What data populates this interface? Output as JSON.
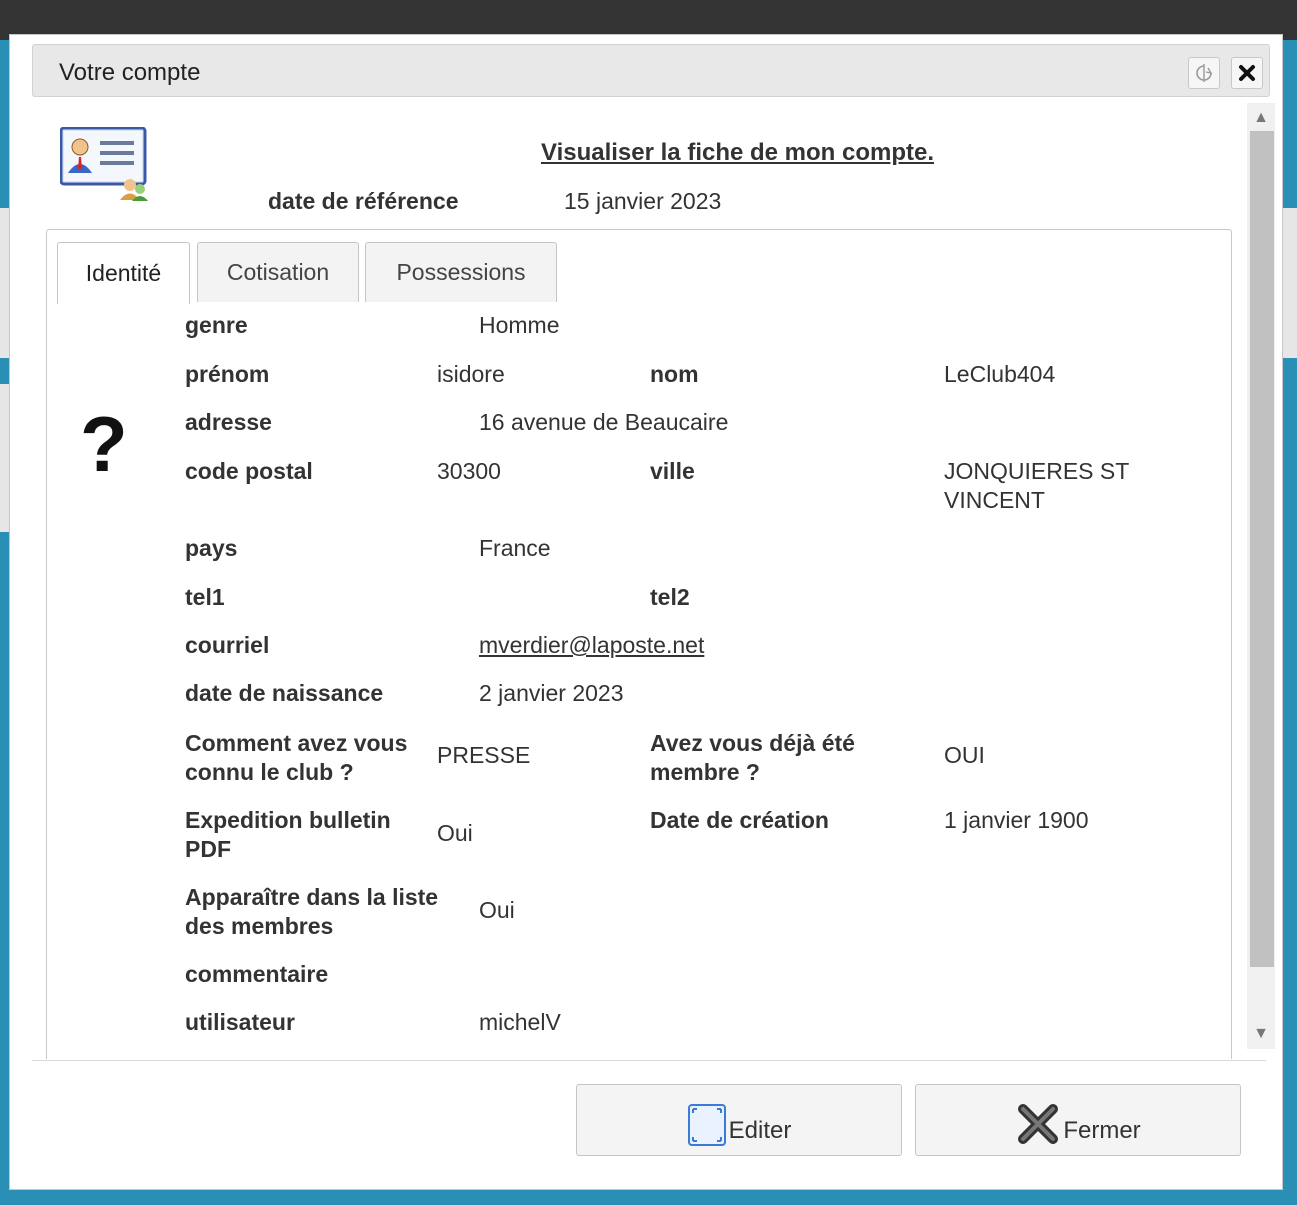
{
  "dialog": {
    "title": "Votre compte",
    "refresh_icon": "refresh-icon",
    "close_icon": "close-icon"
  },
  "header": {
    "account_icon": "account-card-icon",
    "view_link": "Visualiser la fiche de mon compte.",
    "ref_label": "date de référence",
    "ref_value": "15 janvier 2023"
  },
  "tabs": [
    {
      "label": "Identité",
      "active": true
    },
    {
      "label": "Cotisation",
      "active": false
    },
    {
      "label": "Possessions",
      "active": false
    }
  ],
  "identity": {
    "photo_placeholder": "?",
    "genre_label": "genre",
    "genre_value": "Homme",
    "prenom_label": "prénom",
    "prenom_value": "isidore",
    "nom_label": "nom",
    "nom_value": "LeClub404",
    "adresse_label": "adresse",
    "adresse_value": "16 avenue de Beaucaire",
    "cp_label": "code postal",
    "cp_value": "30300",
    "ville_label": "ville",
    "ville_value_1": "JONQUIERES ST",
    "ville_value_2": "VINCENT",
    "pays_label": "pays",
    "pays_value": "France",
    "tel1_label": "tel1",
    "tel2_label": "tel2",
    "courriel_label": "courriel",
    "courriel_value": "mverdier@laposte.net",
    "naissance_label": "date de naissance",
    "naissance_value": "2 janvier 2023",
    "connu_label_1": "Comment avez vous",
    "connu_label_2": "connu le club ?",
    "connu_value": "PRESSE",
    "membre_label_1": "Avez vous déjà été",
    "membre_label_2": "membre ?",
    "membre_value": "OUI",
    "expedition_label_1": "Expedition bulletin",
    "expedition_label_2": "PDF",
    "expedition_value": "Oui",
    "creation_label": "Date de création",
    "creation_value": "1 janvier 1900",
    "liste_label_1": "Apparaître dans la liste",
    "liste_label_2": "des membres",
    "liste_value": "Oui",
    "commentaire_label": "commentaire",
    "utilisateur_label": "utilisateur",
    "utilisateur_value": "michelV"
  },
  "footer": {
    "edit_label": "Editer",
    "edit_icon": "edit-icon",
    "close_label": "Fermer",
    "close_icon": "close-x-icon"
  }
}
